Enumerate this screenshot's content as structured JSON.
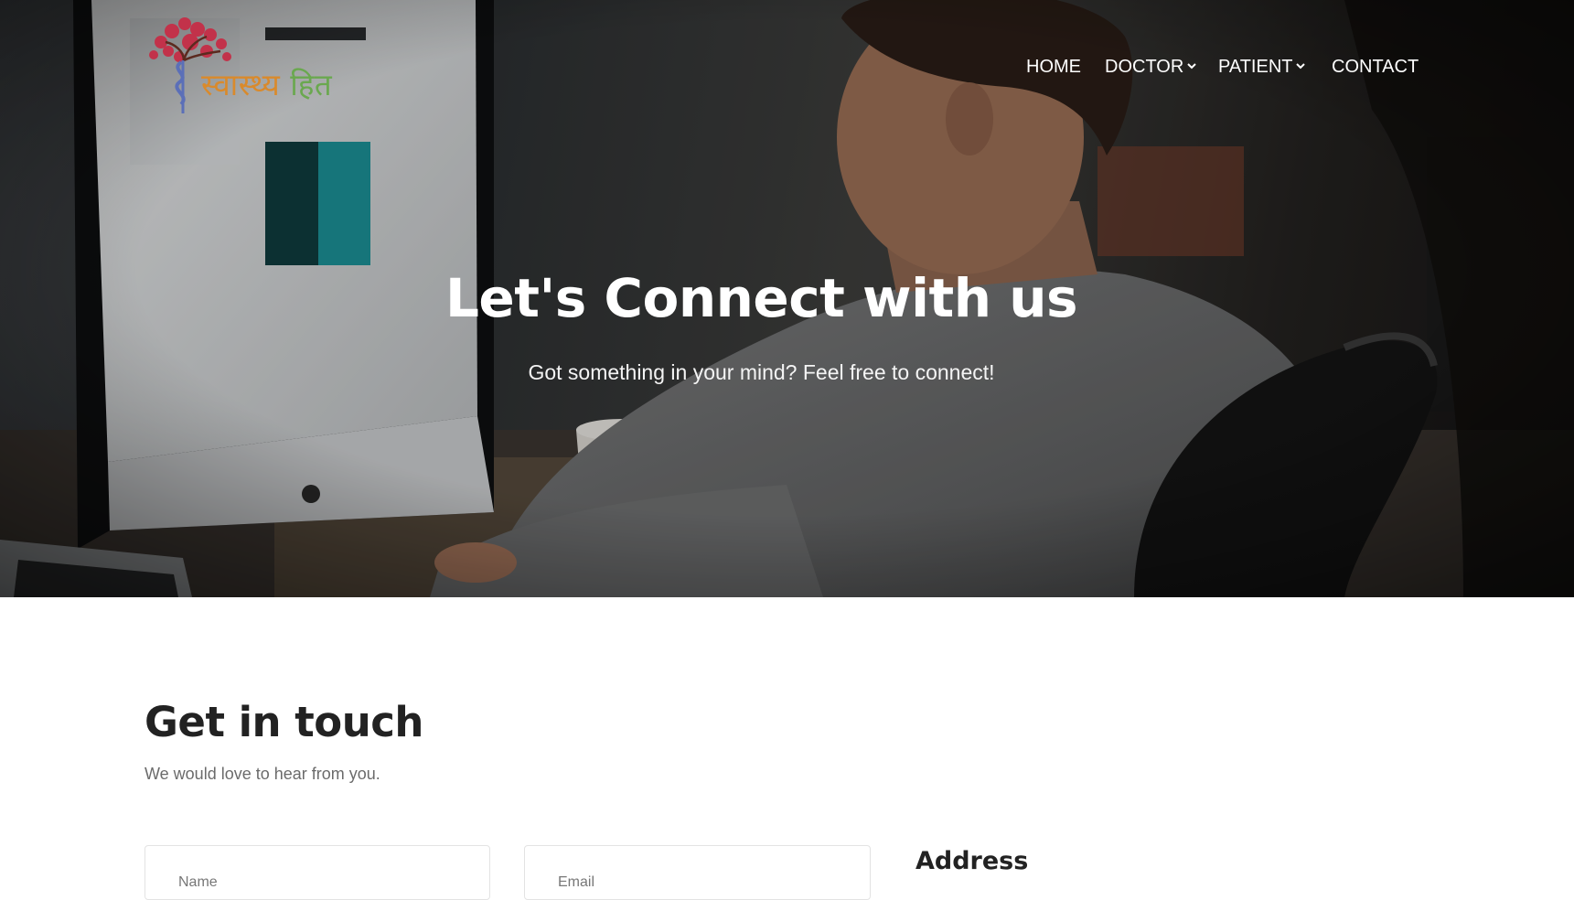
{
  "logo": {
    "text_part1": "स्वास्थ्य",
    "text_part2": "हित"
  },
  "nav": {
    "items": [
      {
        "label": "HOME",
        "dropdown": false
      },
      {
        "label": "DOCTOR",
        "dropdown": true
      },
      {
        "label": "PATIENT",
        "dropdown": true
      },
      {
        "label": "CONTACT",
        "dropdown": false
      }
    ]
  },
  "hero": {
    "title": "Let's Connect with us",
    "subtitle": "Got something in your mind? Feel free to connect!"
  },
  "contact": {
    "title": "Get in touch",
    "subtitle": "We would love to hear from you.",
    "name_placeholder": "Name",
    "email_placeholder": "Email",
    "address_heading": "Address"
  },
  "colors": {
    "logo_saffron": "#d98a2c",
    "logo_green": "#6aa84f",
    "logo_tree": "#c2324a",
    "logo_staff": "#5b6fb8",
    "heading_dark": "#222222"
  }
}
